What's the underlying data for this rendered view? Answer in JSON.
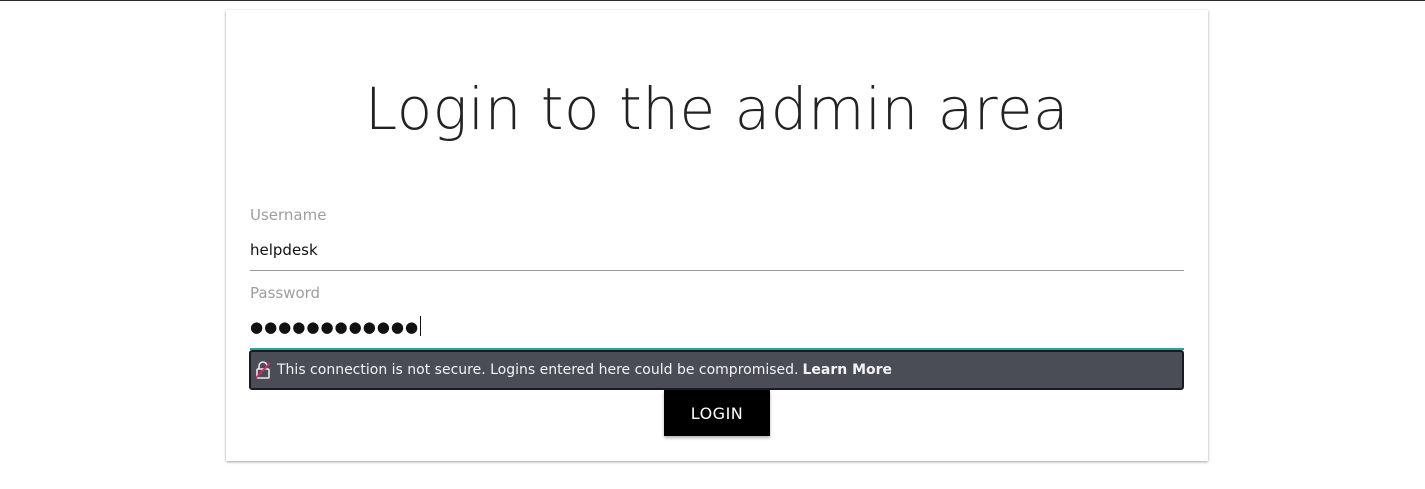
{
  "page": {
    "title": "Login to the admin area"
  },
  "form": {
    "username": {
      "label": "Username",
      "value": "helpdesk"
    },
    "password": {
      "label": "Password",
      "masked_value": "●●●●●●●●●●●●"
    },
    "submit_label": "LOGIN"
  },
  "security_warning": {
    "icon": "insecure-lock-icon",
    "message": "This connection is not secure. Logins entered here could be compromised.",
    "link_label": "Learn More"
  },
  "colors": {
    "accent_underline": "#26a69a",
    "warning_bg": "#4b4d56",
    "button_bg": "#000000",
    "title_text": "#222222"
  }
}
